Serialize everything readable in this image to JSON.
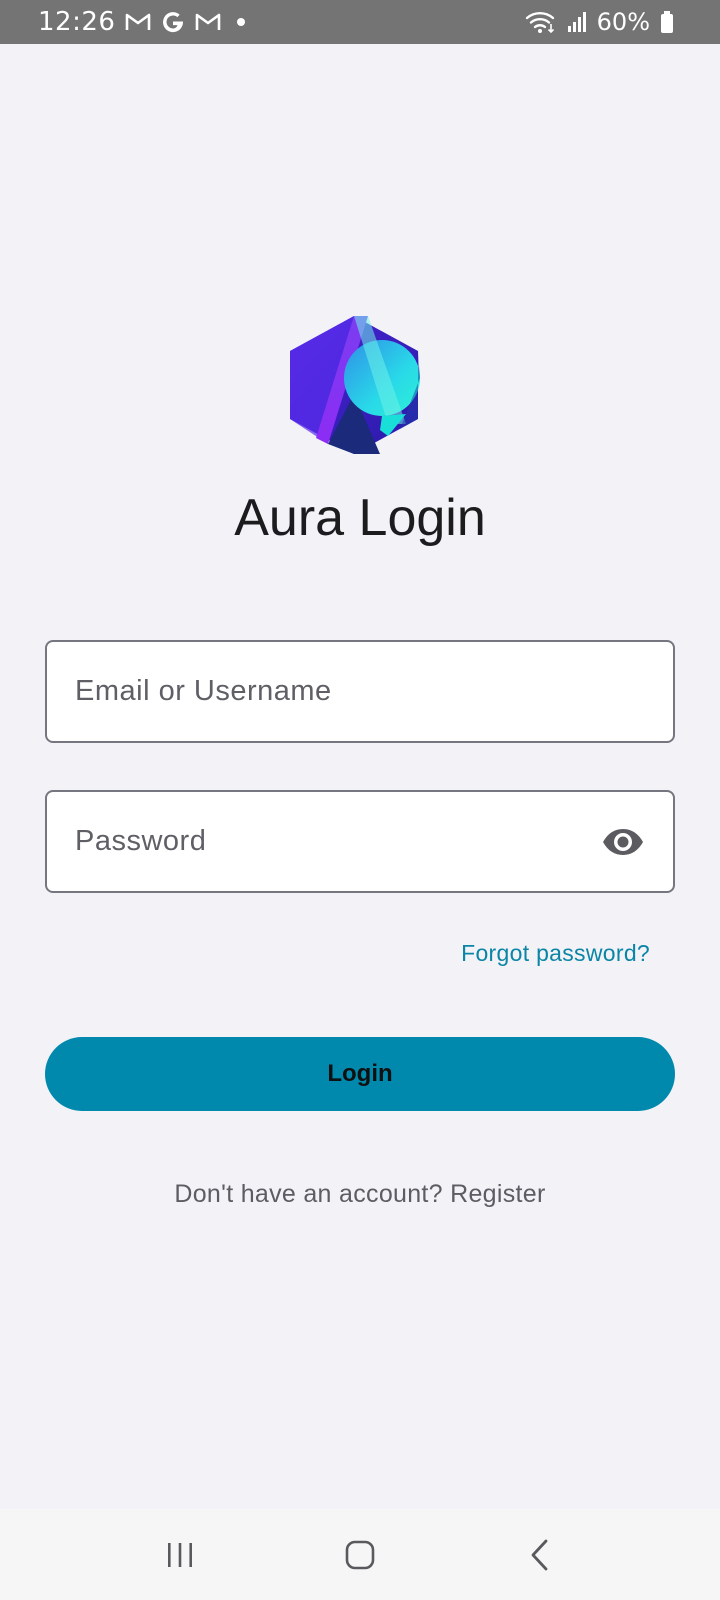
{
  "status_bar": {
    "time": "12:26",
    "battery": "60%",
    "notification_icons": [
      "gmail-icon",
      "google-icon",
      "gmail-icon",
      "dot"
    ],
    "system_icons": [
      "wifi-icon",
      "signal-icon",
      "battery-icon"
    ]
  },
  "app": {
    "title": "Aura Login",
    "logo_icon": "aura-hexagon-logo"
  },
  "form": {
    "email_placeholder": "Email or Username",
    "email_value": "",
    "password_placeholder": "Password",
    "password_value": "",
    "forgot_password": "Forgot password?",
    "login_label": "Login",
    "register_text": "Don't have an account? Register"
  },
  "colors": {
    "background": "#f2f2f7",
    "accent": "#0088ad",
    "link": "#0b85a6",
    "status_bar": "#747474"
  },
  "nav_bar": {
    "buttons": [
      "recent-apps-icon",
      "home-icon",
      "back-icon"
    ]
  }
}
